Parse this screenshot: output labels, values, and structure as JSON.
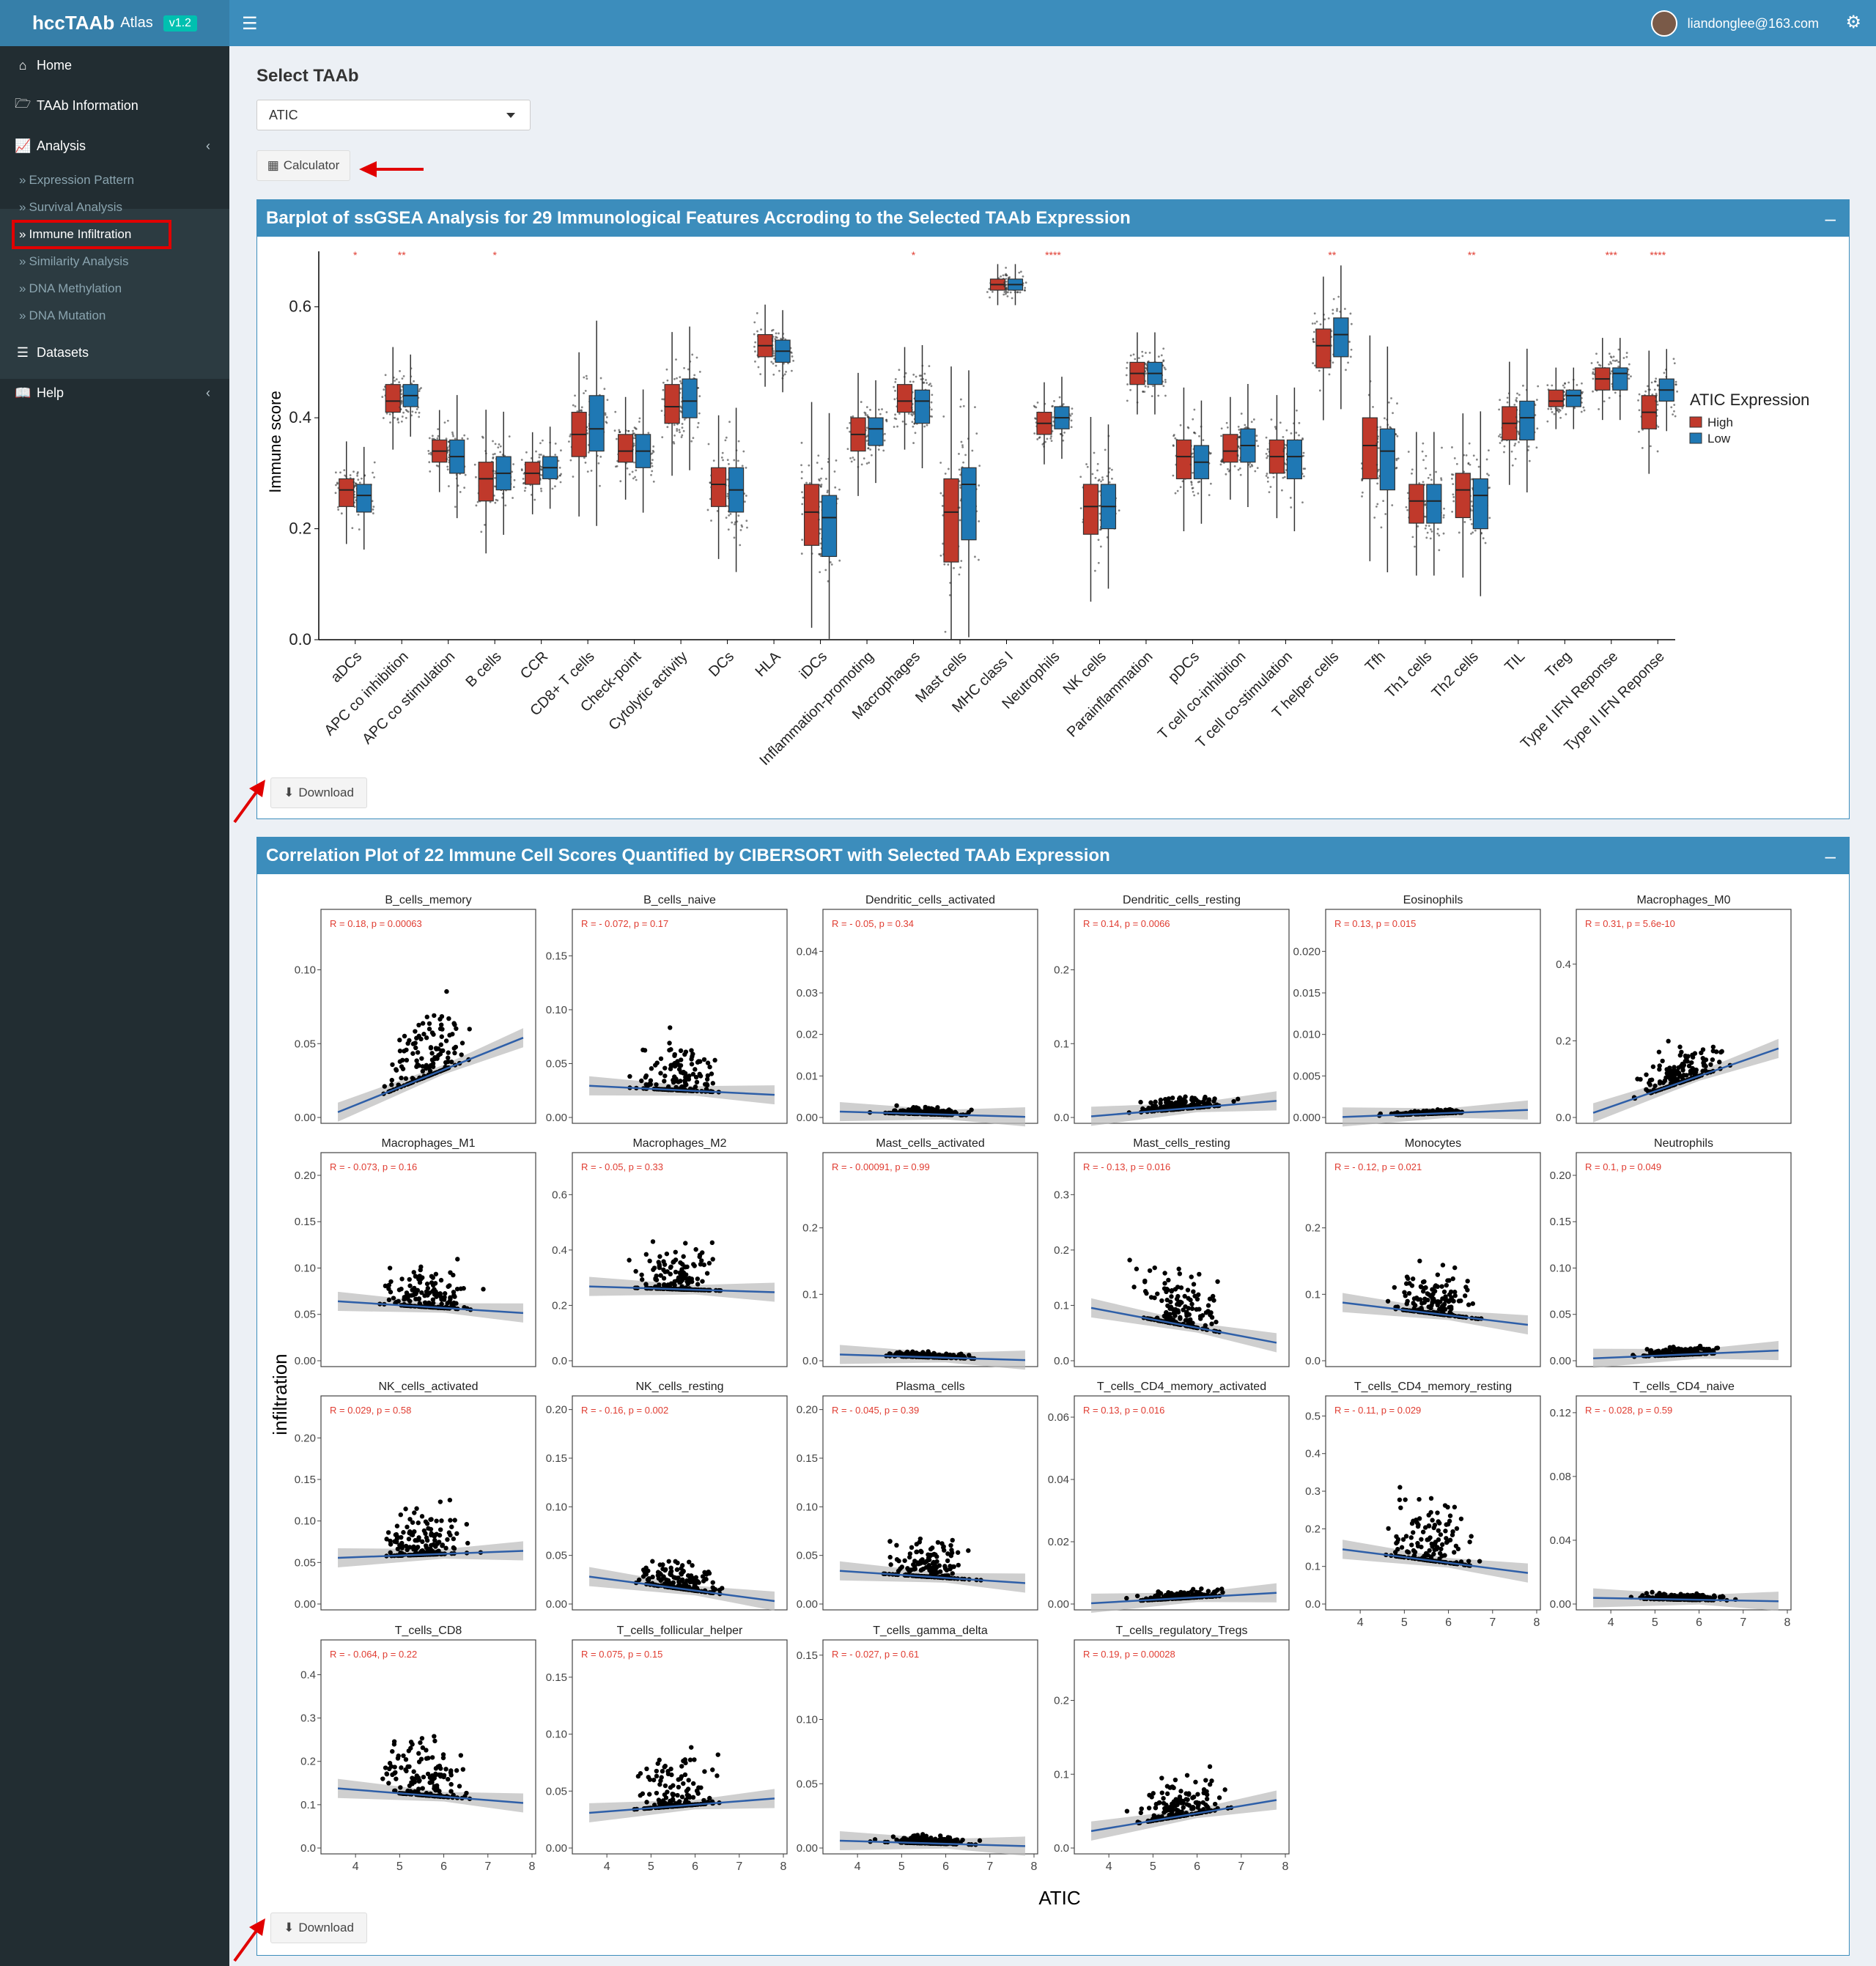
{
  "app": {
    "name_bold": "hccTAAb",
    "name_light": "Atlas",
    "version": "v1.2",
    "user_email": "liandonglee@163.com"
  },
  "icons": {
    "menu": "hamburger-icon",
    "user": "avatar-icon",
    "settings": "gears-icon",
    "home": "home-icon",
    "taab": "folder-open-icon",
    "analysis": "line-chart-icon",
    "datasets": "database-icon",
    "help": "book-icon",
    "sub": "double-chevron-right-icon",
    "calculator": "calculator-icon",
    "download": "download-icon"
  },
  "sidebar": {
    "home": "Home",
    "taab_info": "TAAb Information",
    "analysis": "Analysis",
    "sub": [
      "Expression Pattern",
      "Survival Analysis",
      "Immune Infiltration",
      "Similarity Analysis",
      "DNA Methylation",
      "DNA Mutation"
    ],
    "active_sub": "Immune Infiltration",
    "datasets": "Datasets",
    "help": "Help"
  },
  "main": {
    "select_label": "Select TAAb",
    "selected_taab": "ATIC",
    "calculator_label": "Calculator",
    "download_label": "Download",
    "minimize": "–",
    "panel1_title": "Barplot of ssGSEA Analysis for 29 Immunological Features Accroding to the Selected TAAb Expression",
    "panel2_title": "Correlation Plot of 22 Immune Cell Scores Quantified by CIBERSORT with Selected TAAb Expression"
  },
  "chart_data": [
    {
      "type": "box",
      "ylabel": "Immune score",
      "ylim": [
        0.0,
        0.7
      ],
      "yticks": [
        "0.0",
        "0.2",
        "0.4",
        "0.6"
      ],
      "legend_title": "ATIC Expression",
      "legend_position": "right",
      "series_colors": {
        "High": "#c0392b",
        "Low": "#1f78b4"
      },
      "categories": [
        "aDCs",
        "APC co inhibition",
        "APC co stimulation",
        "B cells",
        "CCR",
        "CD8+ T cells",
        "Check-point",
        "Cytolytic activity",
        "DCs",
        "HLA",
        "iDCs",
        "Inflammation-promoting",
        "Macrophages",
        "Mast cells",
        "MHC class I",
        "Neutrophils",
        "NK cells",
        "Parainflammation",
        "pDCs",
        "T cell co-inhibition",
        "T cell co-stimulation",
        "T helper cells",
        "Tfh",
        "Th1 cells",
        "Th2 cells",
        "TIL",
        "Treg",
        "Type I IFN Reponse",
        "Type II IFN Reponse"
      ],
      "significance": [
        "*",
        "**",
        "",
        "*",
        "",
        "",
        "",
        "",
        "",
        "",
        "",
        "",
        "*",
        "",
        "",
        "****",
        "",
        "",
        "",
        "",
        "",
        "**",
        "",
        "",
        "**",
        "",
        "",
        "***",
        "****"
      ],
      "series": [
        {
          "name": "High",
          "median": [
            0.27,
            0.43,
            0.34,
            0.29,
            0.3,
            0.37,
            0.34,
            0.42,
            0.28,
            0.53,
            0.23,
            0.37,
            0.43,
            0.23,
            0.64,
            0.39,
            0.24,
            0.48,
            0.33,
            0.34,
            0.33,
            0.53,
            0.35,
            0.25,
            0.27,
            0.39,
            0.43,
            0.47,
            0.41
          ],
          "q1": [
            0.24,
            0.41,
            0.32,
            0.25,
            0.28,
            0.33,
            0.32,
            0.39,
            0.24,
            0.51,
            0.17,
            0.34,
            0.41,
            0.14,
            0.63,
            0.37,
            0.19,
            0.46,
            0.29,
            0.32,
            0.3,
            0.49,
            0.29,
            0.21,
            0.22,
            0.36,
            0.42,
            0.45,
            0.38
          ],
          "q3": [
            0.29,
            0.46,
            0.36,
            0.32,
            0.32,
            0.41,
            0.37,
            0.46,
            0.31,
            0.55,
            0.28,
            0.4,
            0.46,
            0.29,
            0.65,
            0.41,
            0.28,
            0.5,
            0.36,
            0.37,
            0.36,
            0.56,
            0.4,
            0.28,
            0.3,
            0.42,
            0.45,
            0.49,
            0.44
          ]
        },
        {
          "name": "Low",
          "median": [
            0.26,
            0.44,
            0.33,
            0.3,
            0.31,
            0.38,
            0.34,
            0.43,
            0.27,
            0.52,
            0.22,
            0.38,
            0.43,
            0.28,
            0.64,
            0.4,
            0.24,
            0.48,
            0.32,
            0.35,
            0.33,
            0.55,
            0.34,
            0.25,
            0.26,
            0.4,
            0.44,
            0.48,
            0.45
          ],
          "q1": [
            0.23,
            0.42,
            0.3,
            0.27,
            0.29,
            0.34,
            0.31,
            0.4,
            0.23,
            0.5,
            0.15,
            0.35,
            0.39,
            0.18,
            0.63,
            0.38,
            0.2,
            0.46,
            0.29,
            0.32,
            0.29,
            0.51,
            0.27,
            0.21,
            0.2,
            0.36,
            0.42,
            0.45,
            0.43
          ],
          "q3": [
            0.28,
            0.46,
            0.36,
            0.33,
            0.33,
            0.44,
            0.37,
            0.47,
            0.31,
            0.54,
            0.26,
            0.4,
            0.45,
            0.31,
            0.65,
            0.42,
            0.28,
            0.5,
            0.35,
            0.38,
            0.36,
            0.58,
            0.38,
            0.28,
            0.29,
            0.43,
            0.45,
            0.49,
            0.47
          ]
        }
      ]
    },
    {
      "type": "scatter",
      "xlabel": "ATIC",
      "ylabel": "infiltration",
      "xlim": [
        3.3,
        8.0
      ],
      "xticks": [
        "4",
        "5",
        "6",
        "7",
        "8"
      ],
      "panels": [
        {
          "title": "B_cells_memory",
          "stat": "R = 0.18, p = 0.00063",
          "ymax": 0.135,
          "yticks": [
            "0.00",
            "0.05",
            "0.10"
          ],
          "fit": [
            0.0,
            0.012,
            0.5
          ]
        },
        {
          "title": "B_cells_naive",
          "stat": "R = - 0.072, p = 0.17",
          "ymax": 0.185,
          "yticks": [
            "0.00",
            "0.05",
            "0.10",
            "0.15"
          ],
          "fit": [
            0.03,
            -0.002,
            0.4
          ]
        },
        {
          "title": "Dendritic_cells_activated",
          "stat": "R = - 0.05, p = 0.34",
          "ymax": 0.048,
          "yticks": [
            "0.00",
            "0.01",
            "0.02",
            "0.03",
            "0.04"
          ],
          "fit": [
            0.0015,
            -0.0003,
            0.06
          ]
        },
        {
          "title": "Dendritic_cells_resting",
          "stat": "R = 0.14, p = 0.0066",
          "ymax": 0.27,
          "yticks": [
            "0.0",
            "0.1",
            "0.2"
          ],
          "fit": [
            0.0,
            0.005,
            0.1
          ]
        },
        {
          "title": "Eosinophils",
          "stat": "R = 0.13, p = 0.015",
          "ymax": 0.024,
          "yticks": [
            "0.000",
            "0.005",
            "0.010",
            "0.015",
            "0.020"
          ],
          "fit": [
            0.0,
            0.0002,
            0.03
          ]
        },
        {
          "title": "Macrophages_M0",
          "stat": "R = 0.31, p = 5.6e-10",
          "ymax": 0.52,
          "yticks": [
            "0.0",
            "0.2",
            "0.4"
          ],
          "fit": [
            0.0,
            0.04,
            0.3
          ]
        },
        {
          "title": "Macrophages_M1",
          "stat": "R = - 0.073, p = 0.16",
          "ymax": 0.215,
          "yticks": [
            "0.00",
            "0.05",
            "0.10",
            "0.15",
            "0.20"
          ],
          "fit": [
            0.065,
            -0.003,
            0.3
          ]
        },
        {
          "title": "Macrophages_M2",
          "stat": "R = - 0.05, p = 0.33",
          "ymax": 0.72,
          "yticks": [
            "0.0",
            "0.2",
            "0.4",
            "0.6"
          ],
          "fit": [
            0.27,
            -0.005,
            0.4
          ]
        },
        {
          "title": "Mast_cells_activated",
          "stat": "R = - 0.00091, p = 0.99",
          "ymax": 0.3,
          "yticks": [
            "0.0",
            "0.1",
            "0.2"
          ],
          "fit": [
            0.01,
            -0.002,
            0.04
          ]
        },
        {
          "title": "Mast_cells_resting",
          "stat": "R = - 0.13, p = 0.016",
          "ymax": 0.36,
          "yticks": [
            "0.0",
            "0.1",
            "0.2",
            "0.3"
          ],
          "fit": [
            0.1,
            -0.015,
            0.4
          ]
        },
        {
          "title": "Monocytes",
          "stat": "R = - 0.12, p = 0.021",
          "ymax": 0.3,
          "yticks": [
            "0.0",
            "0.1",
            "0.2"
          ],
          "fit": [
            0.09,
            -0.008,
            0.35
          ]
        },
        {
          "title": "Neutrophils",
          "stat": "R = 0.1, p = 0.049",
          "ymax": 0.215,
          "yticks": [
            "0.00",
            "0.05",
            "0.10",
            "0.15",
            "0.20"
          ],
          "fit": [
            0.002,
            0.002,
            0.06
          ]
        },
        {
          "title": "NK_cells_activated",
          "stat": "R = 0.029, p = 0.58",
          "ymax": 0.24,
          "yticks": [
            "0.00",
            "0.05",
            "0.10",
            "0.15",
            "0.20"
          ],
          "fit": [
            0.055,
            0.002,
            0.4
          ]
        },
        {
          "title": "NK_cells_resting",
          "stat": "R = - 0.16, p = 0.002",
          "ymax": 0.205,
          "yticks": [
            "0.00",
            "0.05",
            "0.10",
            "0.15",
            "0.20"
          ],
          "fit": [
            0.03,
            -0.006,
            0.2
          ]
        },
        {
          "title": "Plasma_cells",
          "stat": "R = - 0.045, p = 0.39",
          "ymax": 0.205,
          "yticks": [
            "0.00",
            "0.05",
            "0.10",
            "0.15",
            "0.20"
          ],
          "fit": [
            0.035,
            -0.003,
            0.3
          ]
        },
        {
          "title": "T_cells_CD4_memory_activated",
          "stat": "R = 0.13, p = 0.016",
          "ymax": 0.064,
          "yticks": [
            "0.00",
            "0.02",
            "0.04",
            "0.06"
          ],
          "fit": [
            0.0,
            0.0008,
            0.06
          ]
        },
        {
          "title": "T_cells_CD4_memory_resting",
          "stat": "R = - 0.11, p = 0.029",
          "ymax": 0.53,
          "yticks": [
            "0.0",
            "0.1",
            "0.2",
            "0.3",
            "0.4",
            "0.5"
          ],
          "fit": [
            0.15,
            -0.015,
            0.5
          ]
        },
        {
          "title": "T_cells_CD4_naive",
          "stat": "R = - 0.028, p = 0.59",
          "ymax": 0.125,
          "yticks": [
            "0.00",
            "0.04",
            "0.08",
            "0.12"
          ],
          "fit": [
            0.004,
            -0.0005,
            0.05
          ]
        },
        {
          "title": "T_cells_CD8",
          "stat": "R = - 0.064, p = 0.22",
          "ymax": 0.46,
          "yticks": [
            "0.0",
            "0.1",
            "0.2",
            "0.3",
            "0.4"
          ],
          "fit": [
            0.14,
            -0.008,
            0.45
          ]
        },
        {
          "title": "T_cells_follicular_helper",
          "stat": "R = 0.075, p = 0.15",
          "ymax": 0.175,
          "yticks": [
            "0.00",
            "0.05",
            "0.10",
            "0.15"
          ],
          "fit": [
            0.03,
            0.003,
            0.4
          ]
        },
        {
          "title": "T_cells_gamma_delta",
          "stat": "R = - 0.027, p = 0.61",
          "ymax": 0.155,
          "yticks": [
            "0.00",
            "0.05",
            "0.10",
            "0.15"
          ],
          "fit": [
            0.006,
            -0.001,
            0.06
          ]
        },
        {
          "title": "T_cells_regulatory_Tregs",
          "stat": "R = 0.19, p = 0.00028",
          "ymax": 0.27,
          "yticks": [
            "0.0",
            "0.1",
            "0.2"
          ],
          "fit": [
            0.02,
            0.01,
            0.3
          ]
        }
      ]
    }
  ]
}
